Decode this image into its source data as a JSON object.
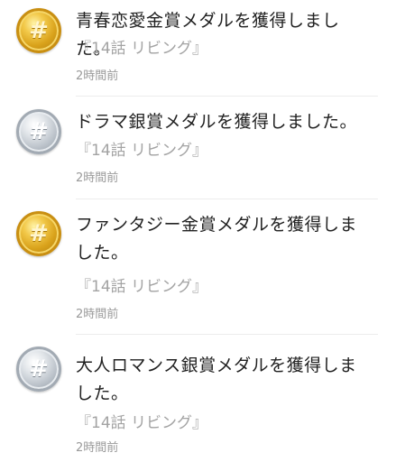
{
  "notifications": [
    {
      "medal_icon": "gold-medal-icon",
      "medal_glyph": "#",
      "message": "青春恋愛金賞メダルを獲得しました。",
      "episode": "『14話 リビング』",
      "time": "2時間前"
    },
    {
      "medal_icon": "silver-medal-icon",
      "medal_glyph": "#",
      "message": "ドラマ銀賞メダルを獲得しました。",
      "episode": "『14話 リビング』",
      "time": "2時間前"
    },
    {
      "medal_icon": "gold-medal-icon",
      "medal_glyph": "#",
      "message": "ファンタジー金賞メダルを獲得しました。",
      "episode": "『14話 リビング』",
      "time": "2時間前"
    },
    {
      "medal_icon": "silver-medal-icon",
      "medal_glyph": "#",
      "message": "大人ロマンス銀賞メダルを獲得しました。",
      "episode": "『14話 リビング』",
      "time": "2時間前"
    }
  ],
  "colors": {
    "gold": "#d9a21b",
    "silver": "#b9c0c8",
    "text": "#222222",
    "muted": "#a3a3a3"
  }
}
